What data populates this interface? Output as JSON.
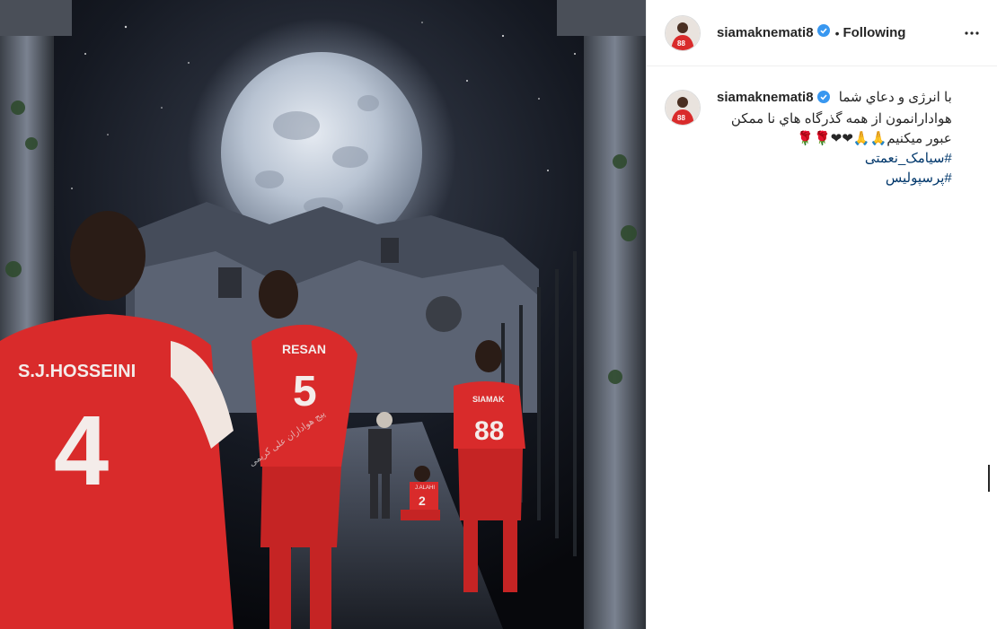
{
  "post": {
    "username": "siamaknemati8",
    "follow_status": "Following",
    "dot": "•",
    "more_label": "More options"
  },
  "caption": {
    "username": "siamaknemati8",
    "line1": "با انرژی و دعاي شما",
    "line2": "هوادارانمون از همه گذرگاه هاي نا ممکن",
    "line3": "عبور میکنیم🙏🙏❤❤🌹🌹",
    "hashtags": [
      "#سیامک_نعمتی",
      "#پرسپولیس"
    ]
  },
  "image": {
    "jerseys": [
      {
        "name": "S.J.HOSSEINI",
        "number": "4"
      },
      {
        "name": "RESAN",
        "number": "5"
      },
      {
        "name": "SIAMAK",
        "number": "88"
      },
      {
        "name": "J.ALAHI",
        "number": "2"
      }
    ],
    "watermark": "پیج هواداران علی کریمی"
  },
  "avatar": {
    "number": "88"
  },
  "colors": {
    "verified": "#3897f0",
    "hashtag": "#00376b",
    "jersey": "#d92b2b"
  }
}
